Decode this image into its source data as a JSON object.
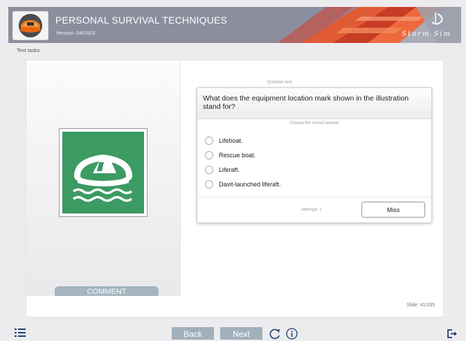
{
  "header": {
    "title": "PERSONAL SURVIVAL TECHNIQUES",
    "version": "Version: 04/2023",
    "brand": "Storm Sim",
    "logo_icon": "liferaft-logo-icon",
    "color": "#8b8e9e"
  },
  "breadcrumb": "Test tasks",
  "illustration": {
    "icon": "liferaft-location-mark-icon",
    "color": "#3c9a63"
  },
  "comment_label": "COMMENT",
  "question": {
    "label": "Question text:",
    "text": "What does the equipment location mark shown in the illustration stand for?",
    "choose_label": "Choose the correct answer",
    "options": [
      "Lifeboat.",
      "Rescue boat.",
      "Liferaft.",
      "Davit-launched liferaft."
    ],
    "attempt": "Attempt: 1",
    "miss_label": "Miss"
  },
  "slide": "Slide: 41/335",
  "footer": {
    "back_label": "Back",
    "next_label": "Next",
    "menu_icon": "list-menu-icon",
    "reload_icon": "reload-icon",
    "info_icon": "info-icon",
    "exit_icon": "exit-icon",
    "button_color": "#a1b0bc"
  }
}
